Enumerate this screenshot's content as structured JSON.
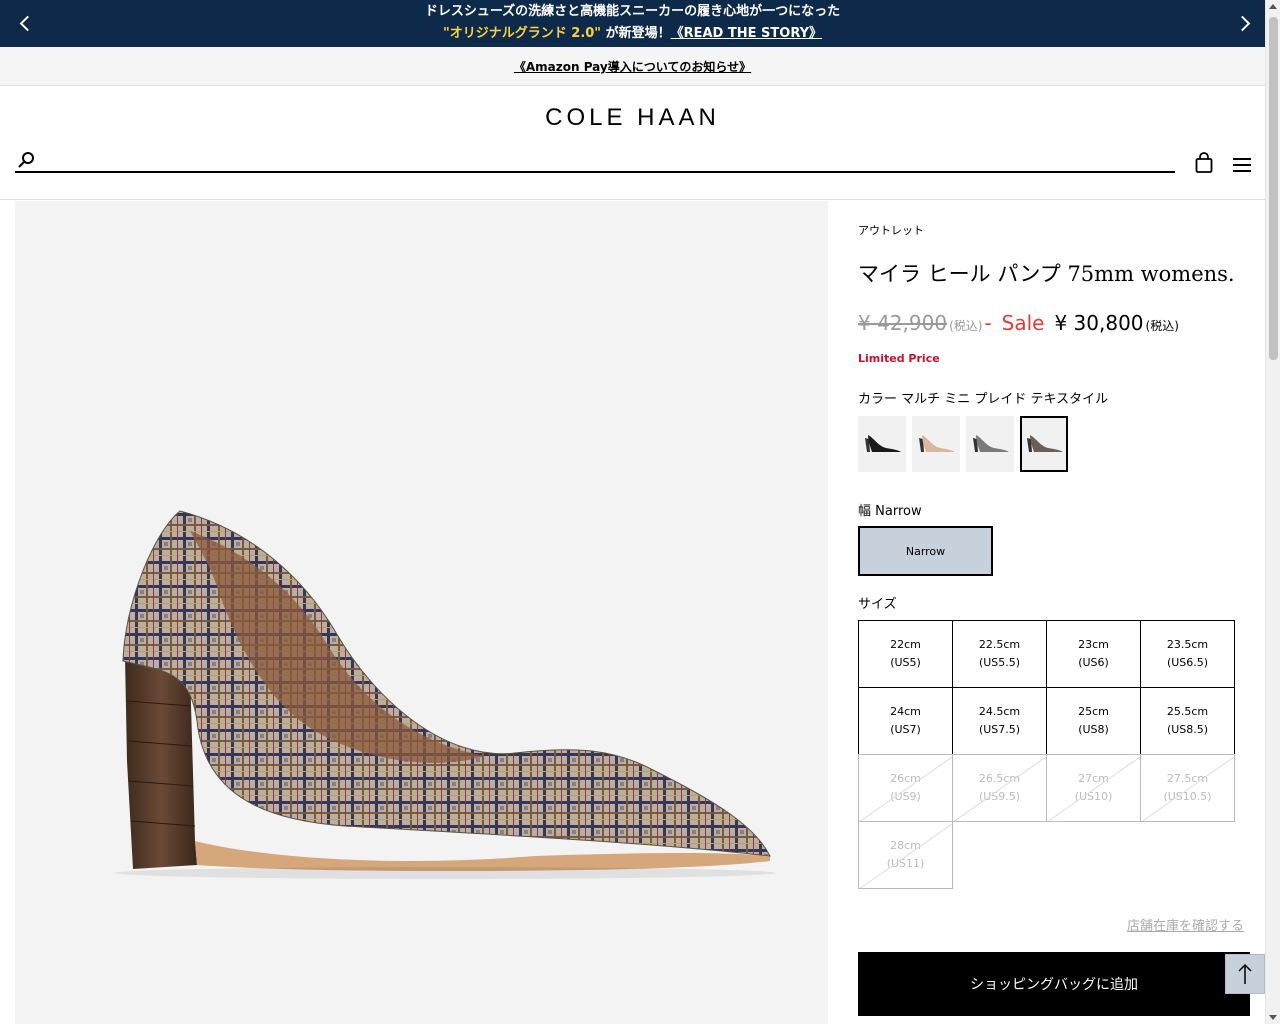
{
  "promo": {
    "line1": "ドレスシューズの洗練さと高機能スニーカーの履き心地が一つになった",
    "highlight": "\"オリジナルグランド 2.0\"",
    "line2_mid": " が新登場！",
    "story_link": "《READ THE STORY》"
  },
  "notice": {
    "link": "《Amazon Pay導入についてのお知らせ》"
  },
  "header": {
    "logo": "COLE HAAN",
    "search_placeholder": ""
  },
  "product": {
    "category": "アウトレット",
    "title": "マイラ ヒール パンプ 75mm womens.",
    "price_original": "¥ 42,900",
    "tax_small": "(税込)",
    "dash": "-",
    "sale_label": "Sale",
    "price_now": "¥ 30,800",
    "tax": "(税込)",
    "limited": "Limited Price",
    "color_label": "カラー マルチ ミニ プレイド テキスタイル",
    "swatches": [
      {
        "name": "black",
        "color": "#1a1a1a"
      },
      {
        "name": "nude",
        "color": "#d9b6a0"
      },
      {
        "name": "grey-plaid",
        "color": "#7a7a7a"
      },
      {
        "name": "multi-plaid",
        "color": "#6b5e55"
      }
    ],
    "width_label": "幅 Narrow",
    "width_option": "Narrow",
    "size_label": "サイズ",
    "sizes": [
      {
        "cm": "22cm",
        "us": "(US5)",
        "available": true
      },
      {
        "cm": "22.5cm",
        "us": "(US5.5)",
        "available": true
      },
      {
        "cm": "23cm",
        "us": "(US6)",
        "available": true
      },
      {
        "cm": "23.5cm",
        "us": "(US6.5)",
        "available": true
      },
      {
        "cm": "24cm",
        "us": "(US7)",
        "available": true
      },
      {
        "cm": "24.5cm",
        "us": "(US7.5)",
        "available": true
      },
      {
        "cm": "25cm",
        "us": "(US8)",
        "available": true
      },
      {
        "cm": "25.5cm",
        "us": "(US8.5)",
        "available": true
      },
      {
        "cm": "26cm",
        "us": "(US9)",
        "available": false
      },
      {
        "cm": "26.5cm",
        "us": "(US9.5)",
        "available": false
      },
      {
        "cm": "27cm",
        "us": "(US10)",
        "available": false
      },
      {
        "cm": "27.5cm",
        "us": "(US10.5)",
        "available": false
      },
      {
        "cm": "28cm",
        "us": "(US11)",
        "available": false
      }
    ],
    "store_link": "店舗在庫を確認する",
    "add_to_bag": "ショッピングバッグに追加"
  }
}
